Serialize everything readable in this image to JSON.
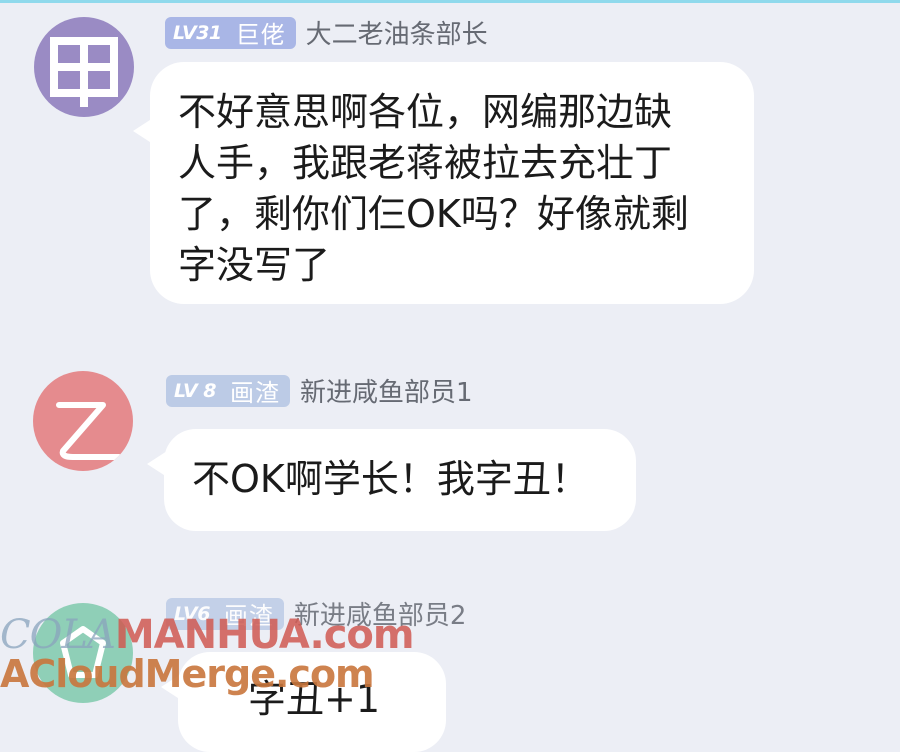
{
  "messages": [
    {
      "level": "LV31",
      "title": "巨佬",
      "role": "大二老油条部长",
      "avatar_icon": "grid-icon",
      "lines": [
        "不好意思啊各位，网编那边缺",
        "人手，我跟老蒋被拉去充壮丁",
        "了，剩你们仨OK吗？好像就剩",
        "字没写了"
      ]
    },
    {
      "level": "LV 8",
      "title": "画渣",
      "role": "新进咸鱼部员1",
      "avatar_icon": "yi-letter-icon",
      "lines": [
        "不OK啊学长！我字丑！"
      ]
    },
    {
      "level": "LV6",
      "title": "画渣",
      "role": "新进咸鱼部员2",
      "avatar_icon": "green-avatar-icon",
      "lines": [
        "字丑+1"
      ]
    }
  ],
  "watermark": {
    "line1_part1": "COLA",
    "line1_part2": "MANHUA.com",
    "line2": "ACloudMerge.com"
  },
  "colors": {
    "background": "#eceef5",
    "bubble": "#ffffff",
    "avatar1": "#9a8bc4",
    "avatar2": "#e58b8e",
    "avatar3": "#8fcfb7",
    "badge": "#bccbe6"
  }
}
